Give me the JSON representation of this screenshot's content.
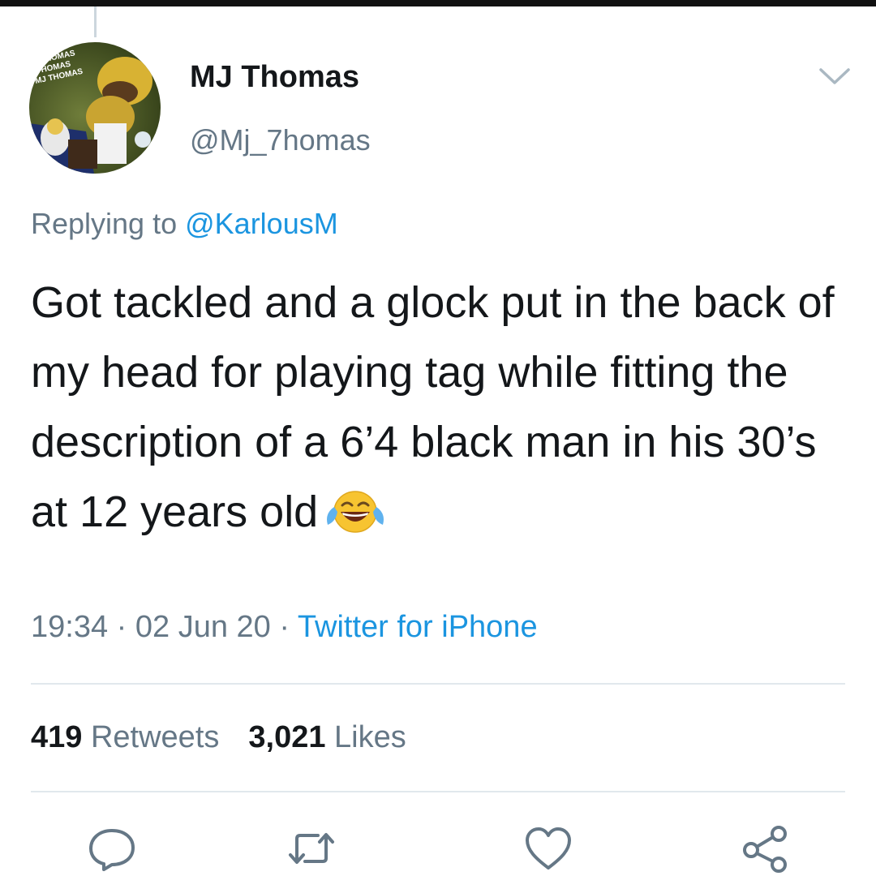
{
  "tweet": {
    "display_name": "MJ Thomas",
    "handle": "@Mj_7homas",
    "reply_prefix": "Replying to ",
    "reply_to": "@KarlousM",
    "text": "Got tackled and a glock put in the back of my head for playing tag while fitting the description of a 6’4 black man in his 30’s at 12 years old",
    "emoji": "face-with-tears-of-joy",
    "time": "19:34",
    "date": "02 Jun 20",
    "separator": " · ",
    "source": "Twitter for iPhone",
    "retweets_count": "419",
    "retweets_label": "Retweets",
    "likes_count": "3,021",
    "likes_label": "Likes"
  },
  "avatar": {
    "lines": [
      "THOMAS",
      "THOMAS",
      "MJ THOMAS"
    ]
  },
  "icons": {
    "menu": "chevron-down-icon",
    "reply": "reply-icon",
    "retweet": "retweet-icon",
    "like": "heart-icon",
    "share": "share-icon"
  },
  "colors": {
    "text": "#14171a",
    "secondary": "#657786",
    "link": "#1b95e0",
    "divider": "#e1e8ed"
  }
}
